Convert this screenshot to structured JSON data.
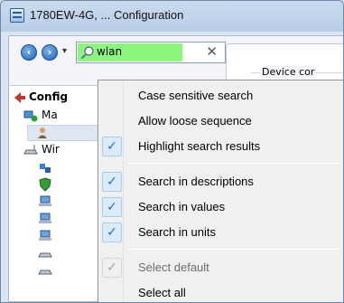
{
  "window": {
    "title": "1780EW-4G, ... Configuration"
  },
  "toolbar": {
    "back_icon": "back-arrow-icon",
    "forward_icon": "forward-arrow-icon",
    "back_glyph": "‹",
    "forward_glyph": "›",
    "dropdown_glyph": "▾",
    "search": {
      "value": "wlan",
      "clear_glyph": "✕",
      "highlight_color": "#8ef57e"
    }
  },
  "panel": {
    "group_label": "Device cor"
  },
  "tree": {
    "items": [
      {
        "label": "Config",
        "icon": "back-nav-icon"
      },
      {
        "label": "Ma",
        "icon": "management-icon"
      },
      {
        "label": "",
        "icon": "user-icon"
      },
      {
        "label": "Wir",
        "icon": "wireless-icon"
      },
      {
        "label": "",
        "icon": "network-icon"
      },
      {
        "label": "",
        "icon": "shield-icon"
      },
      {
        "label": "",
        "icon": "computer-icon"
      },
      {
        "label": "",
        "icon": "computer-icon"
      },
      {
        "label": "",
        "icon": "computer-icon"
      },
      {
        "label": "",
        "icon": "wireless-icon"
      },
      {
        "label": "",
        "icon": "wireless-icon"
      }
    ]
  },
  "menu": {
    "items": [
      {
        "label": "Case sensitive search",
        "checked": false,
        "disabled": false
      },
      {
        "label": "Allow loose sequence",
        "checked": false,
        "disabled": false
      },
      {
        "label": "Highlight search results",
        "checked": true,
        "disabled": false
      },
      {
        "label": "Search in descriptions",
        "checked": true,
        "disabled": false
      },
      {
        "label": "Search in values",
        "checked": true,
        "disabled": false
      },
      {
        "label": "Search in units",
        "checked": true,
        "disabled": false
      },
      {
        "label": "Select default",
        "checked": true,
        "disabled": true
      },
      {
        "label": "Select all",
        "checked": false,
        "disabled": false
      }
    ],
    "check_glyph": "✓"
  }
}
